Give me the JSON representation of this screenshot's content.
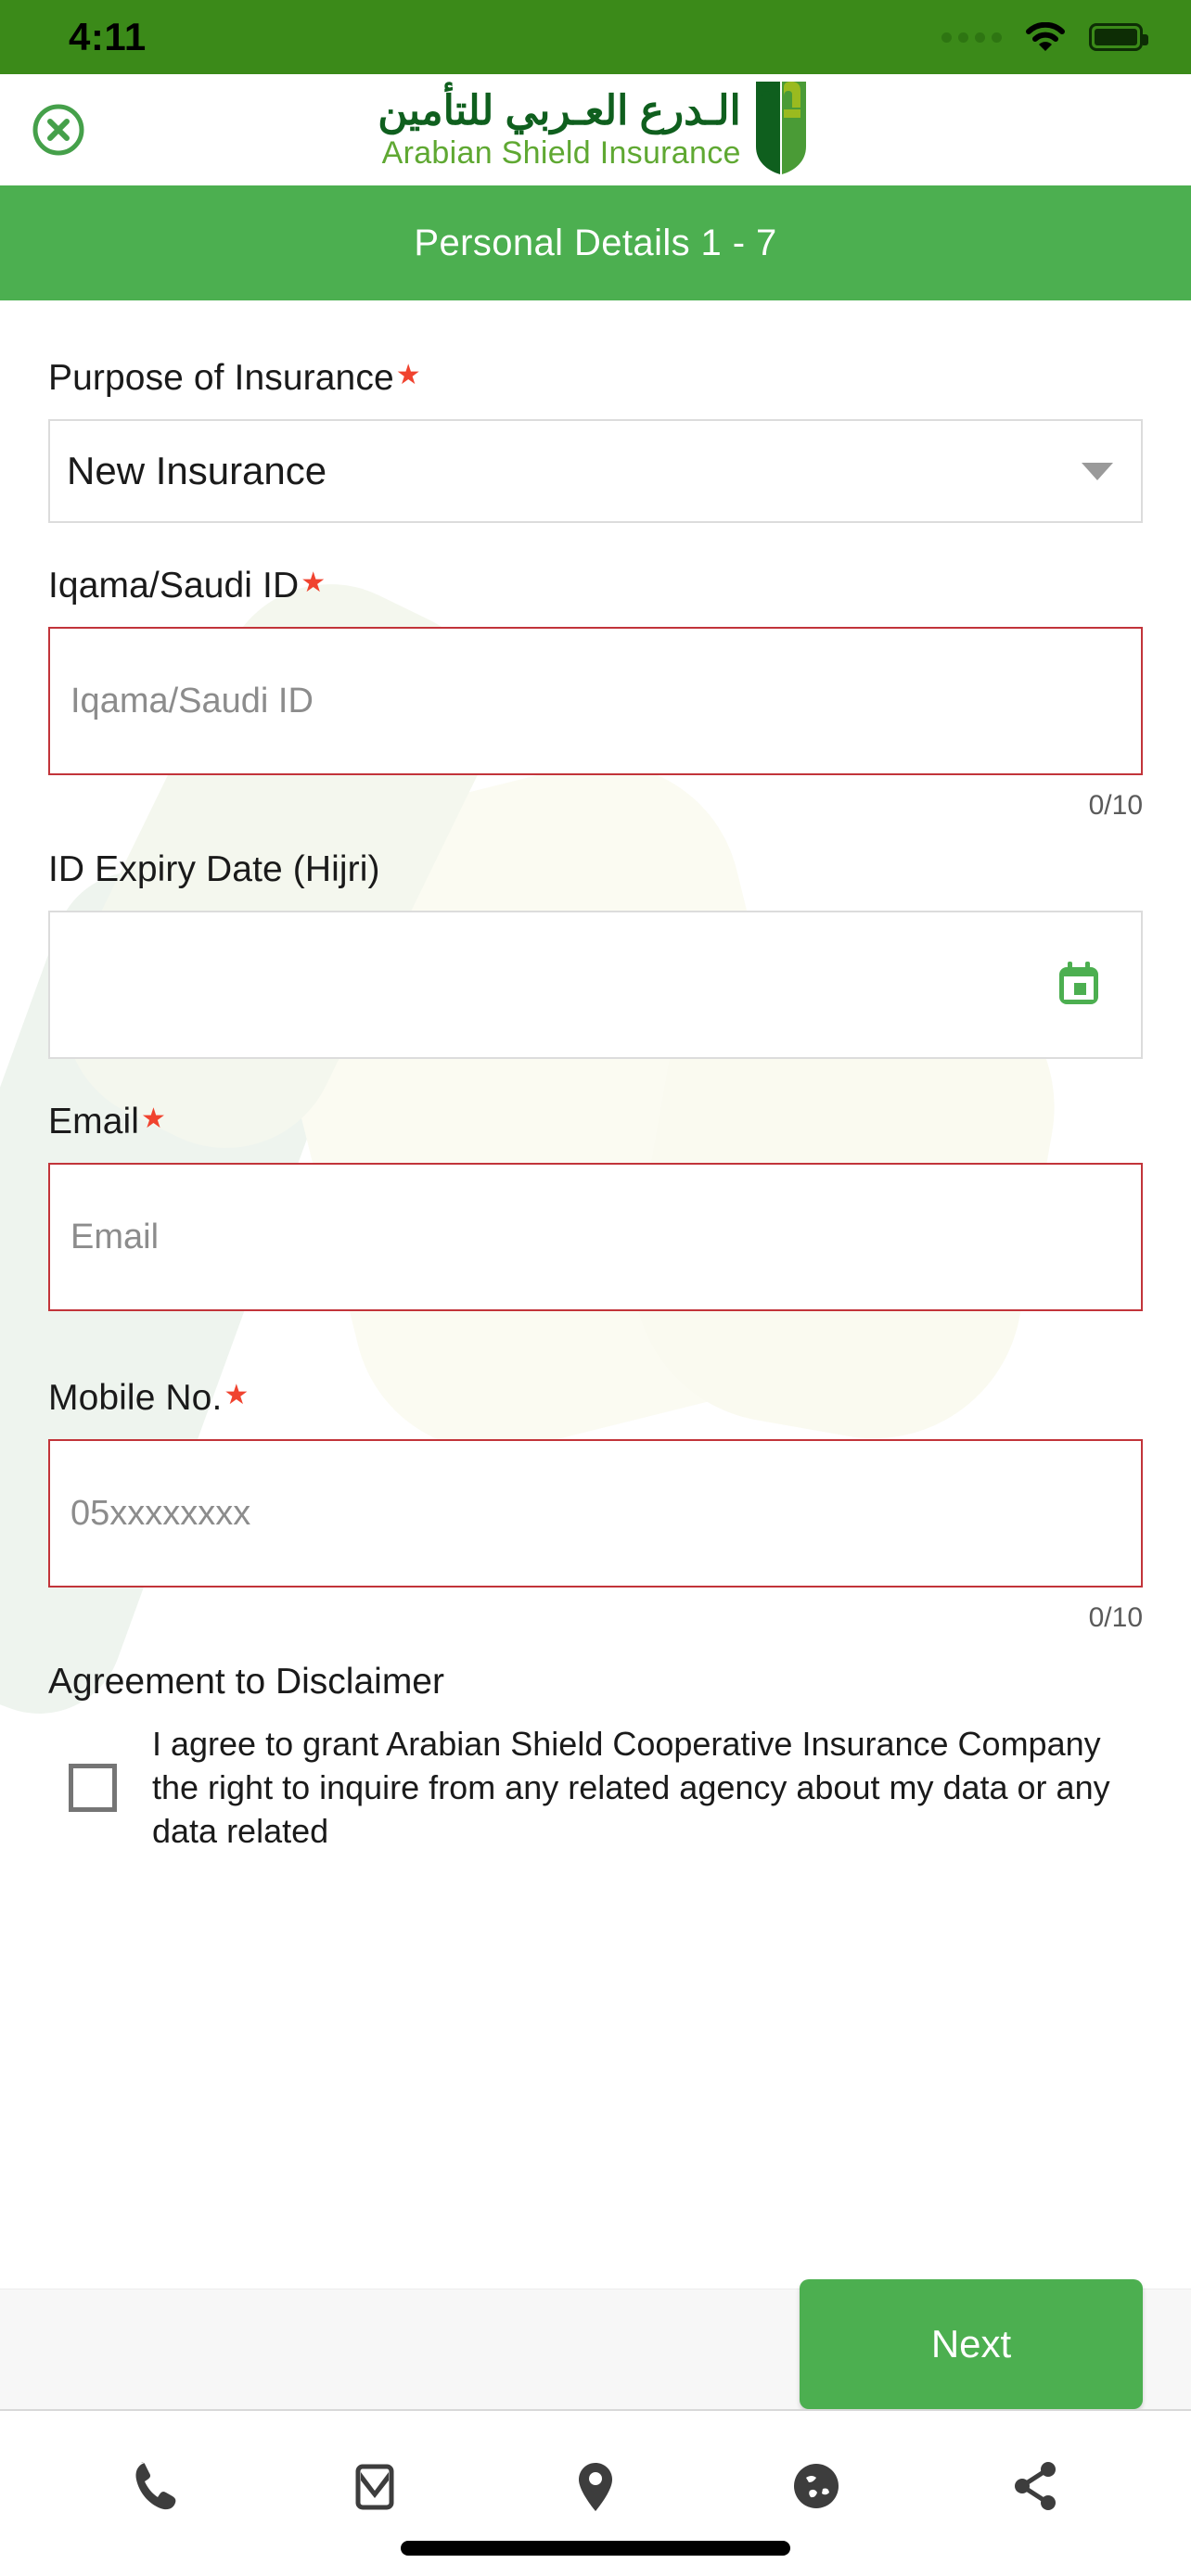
{
  "status_bar": {
    "time": "4:11",
    "signal_icon": "signal-dots-icon",
    "wifi_icon": "wifi-icon",
    "battery_icon": "battery-full-icon",
    "background_color": "#3b8a19"
  },
  "header": {
    "close_icon": "close-circle-icon",
    "logo": {
      "arabic_name": "الـدرع العـربي للتأمين",
      "english_name": "Arabian Shield Insurance",
      "shield_icon": "shield-logo-icon",
      "arabic_color": "#0f5f1e",
      "english_color": "#5fa832"
    }
  },
  "title_bar": {
    "title": "Personal Details  1  -  7",
    "background_color": "#4caf50"
  },
  "form": {
    "purpose": {
      "label": "Purpose of Insurance",
      "required_mark": "★",
      "selected_value": "New Insurance",
      "dropdown_icon": "chevron-down-icon"
    },
    "iqama": {
      "label": "Iqama/Saudi ID",
      "required_mark": "★",
      "placeholder": "Iqama/Saudi ID",
      "value": "",
      "counter": "0/10",
      "error_border_color": "#c2343a"
    },
    "expiry": {
      "label": "ID Expiry Date (Hijri)",
      "placeholder": "",
      "value": "",
      "calendar_icon": "calendar-icon",
      "calendar_color": "#4caf50"
    },
    "email": {
      "label": "Email",
      "required_mark": "★",
      "placeholder": "Email",
      "value": "",
      "error_border_color": "#c2343a"
    },
    "mobile": {
      "label": "Mobile No.",
      "required_mark": "★",
      "placeholder": "05xxxxxxxx",
      "value": "",
      "counter": "0/10",
      "error_border_color": "#c2343a"
    },
    "disclaimer": {
      "title": "Agreement to Disclaimer",
      "checkbox_checked": false,
      "text": "I agree to grant Arabian Shield Cooperative Insurance Company the right to inquire from any related agency about my data or any data related"
    }
  },
  "footer": {
    "next_label": "Next",
    "next_color": "#4caf50"
  },
  "bottom_nav": {
    "items": [
      {
        "icon": "phone-icon"
      },
      {
        "icon": "envelope-icon"
      },
      {
        "icon": "location-pin-icon"
      },
      {
        "icon": "globe-icon"
      },
      {
        "icon": "share-icon"
      }
    ],
    "home_indicator": "home-indicator"
  }
}
